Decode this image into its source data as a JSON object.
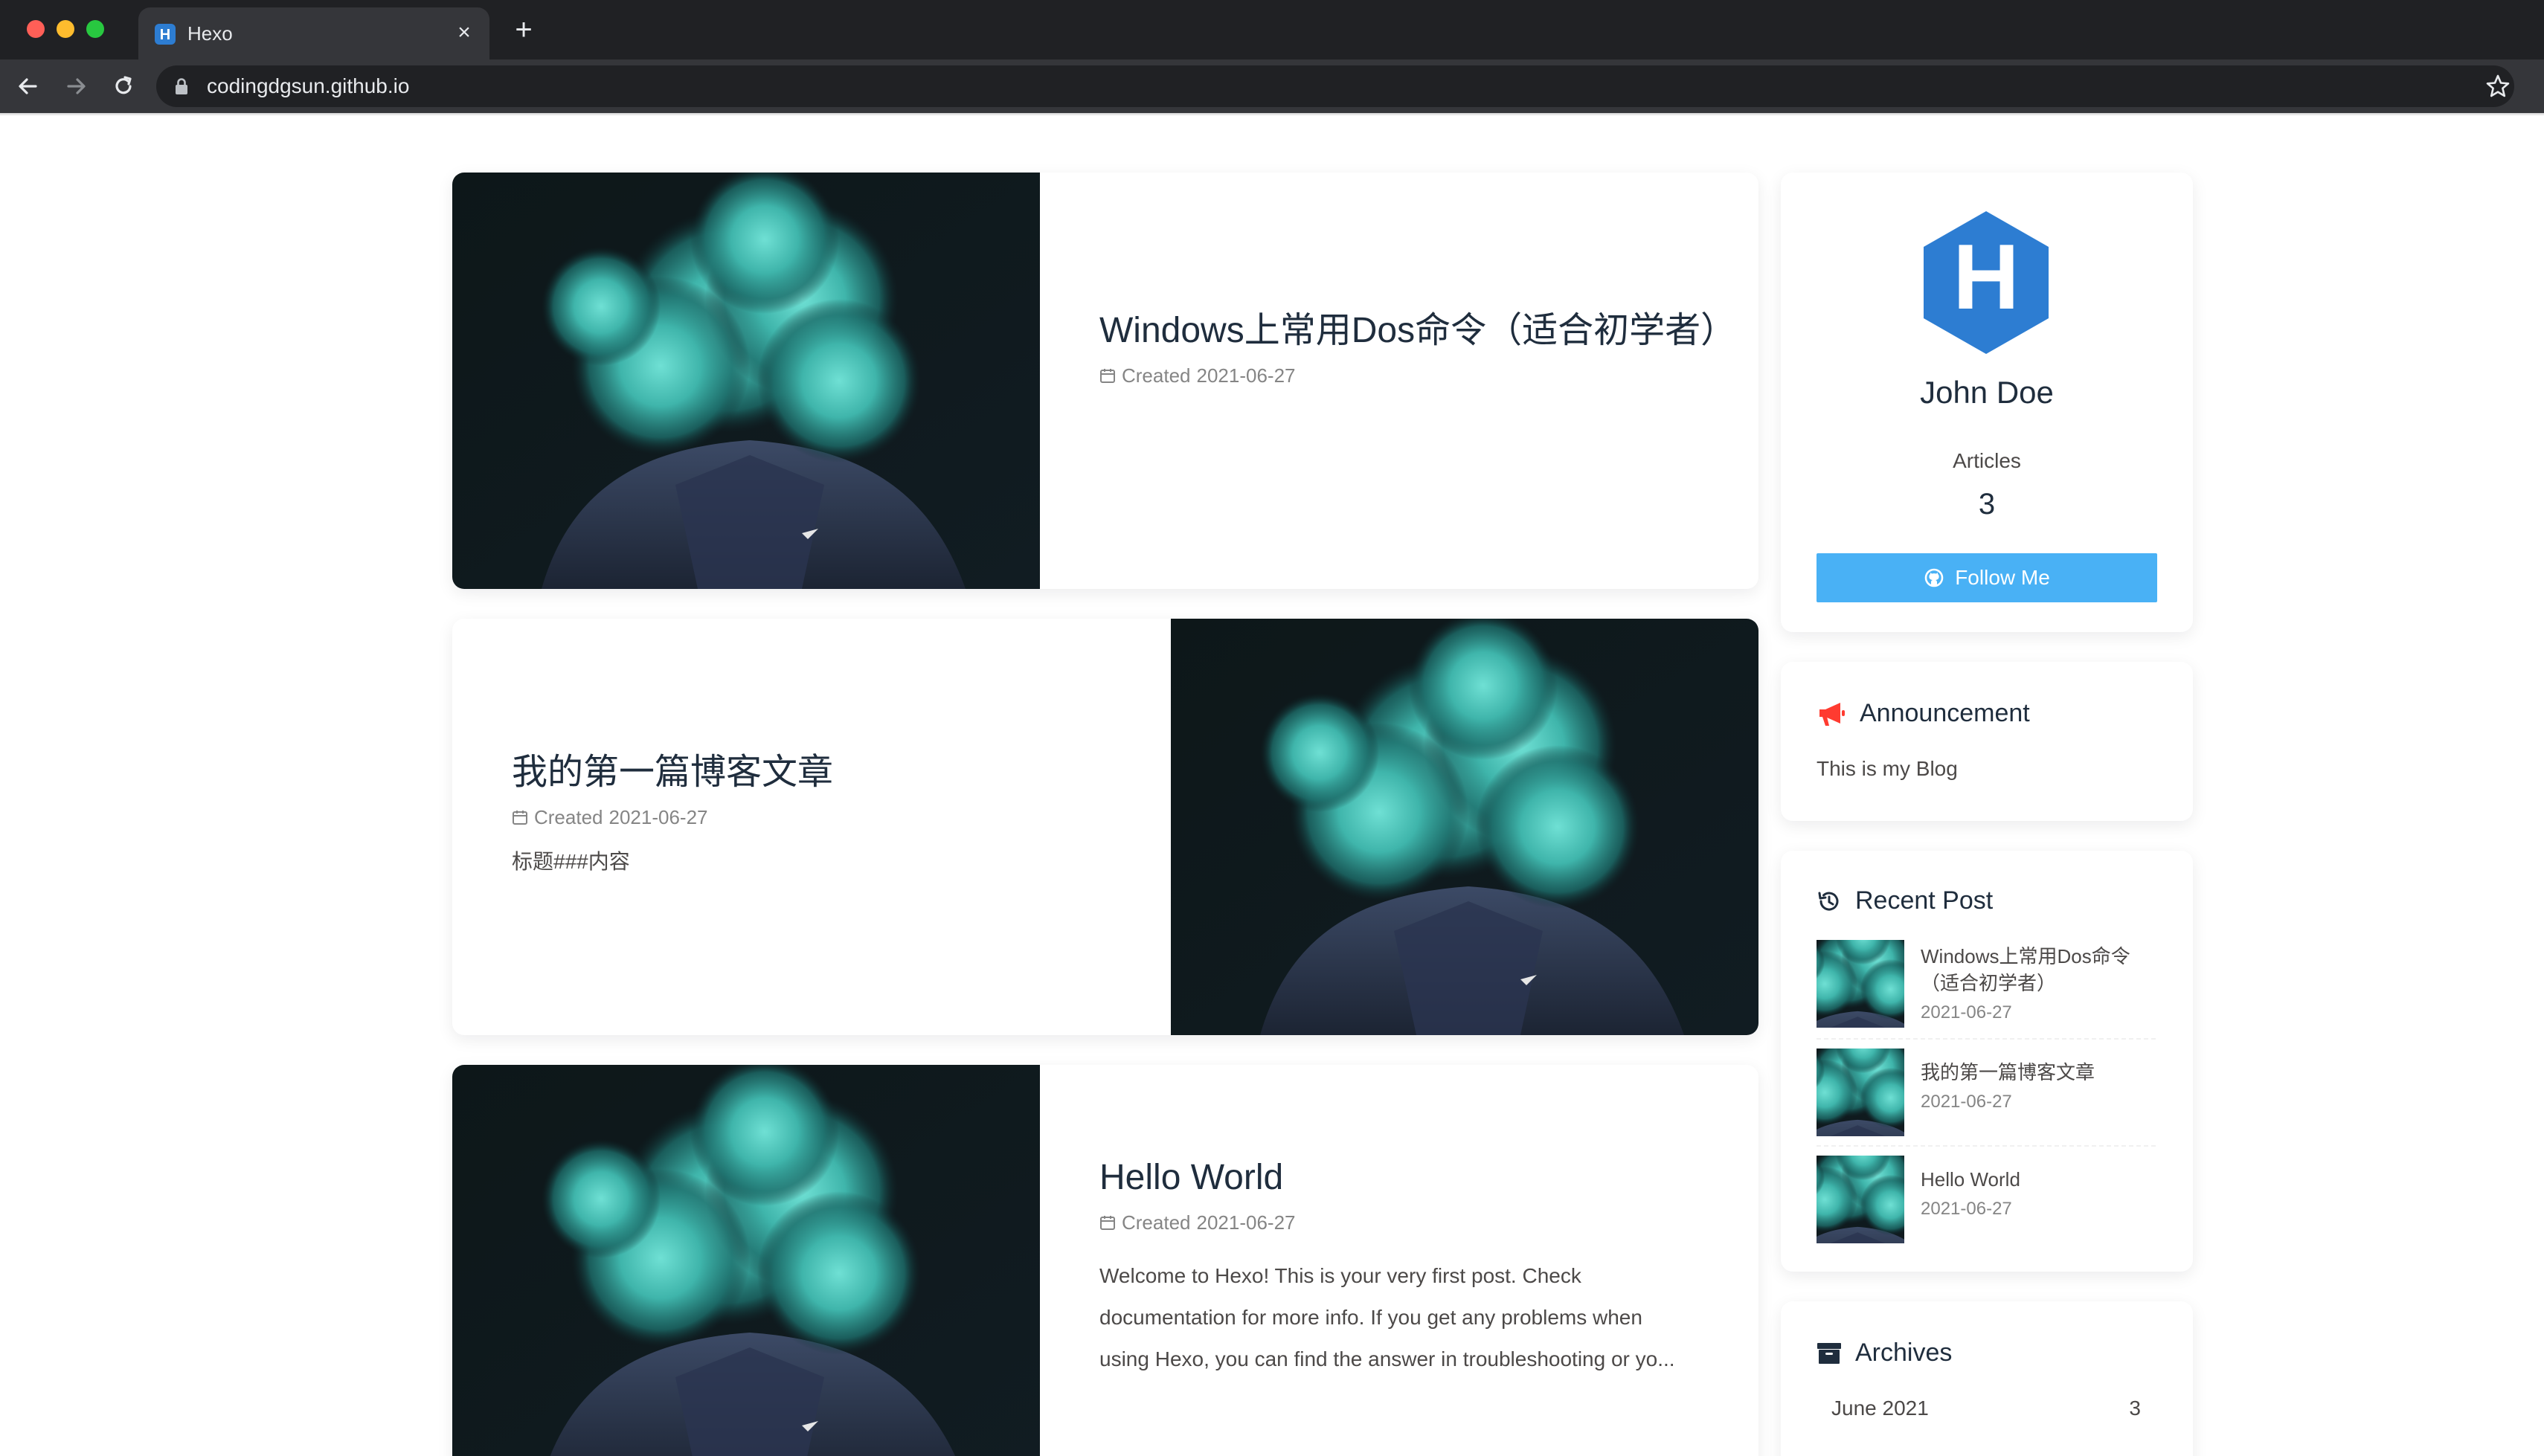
{
  "browser": {
    "tab_title": "Hexo",
    "favicon_letter": "H",
    "url": "codingdgsun.github.io",
    "close_glyph": "×",
    "new_tab_glyph": "+"
  },
  "posts": [
    {
      "title": "Windows上常用Dos命令（适合初学者）",
      "meta_label": "Created",
      "date": "2021-06-27",
      "excerpt": "",
      "cover_side": "left"
    },
    {
      "title": "我的第一篇博客文章",
      "meta_label": "Created",
      "date": "2021-06-27",
      "excerpt": "标题###内容",
      "cover_side": "right"
    },
    {
      "title": "Hello World",
      "meta_label": "Created",
      "date": "2021-06-27",
      "excerpt": "Welcome to Hexo! This is your very first post. Check documentation for more info. If you get any problems when using Hexo, you can find the answer in troubleshooting or yo...",
      "cover_side": "left"
    }
  ],
  "author": {
    "avatar_letter": "H",
    "name": "John Doe",
    "articles_label": "Articles",
    "articles_count": "3",
    "follow_label": "Follow Me"
  },
  "announcement": {
    "heading": "Announcement",
    "text": "This is my Blog"
  },
  "recent": {
    "heading": "Recent Post",
    "items": [
      {
        "title": "Windows上常用Dos命令（适合初学者）",
        "date": "2021-06-27"
      },
      {
        "title": "我的第一篇博客文章",
        "date": "2021-06-27"
      },
      {
        "title": "Hello World",
        "date": "2021-06-27"
      }
    ]
  },
  "archives": {
    "heading": "Archives",
    "rows": [
      {
        "label": "June 2021",
        "count": "3"
      }
    ]
  },
  "colors": {
    "accent": "#49b1f5",
    "announce_icon": "#ff3b30",
    "hexagon": "#2d7dd2"
  }
}
